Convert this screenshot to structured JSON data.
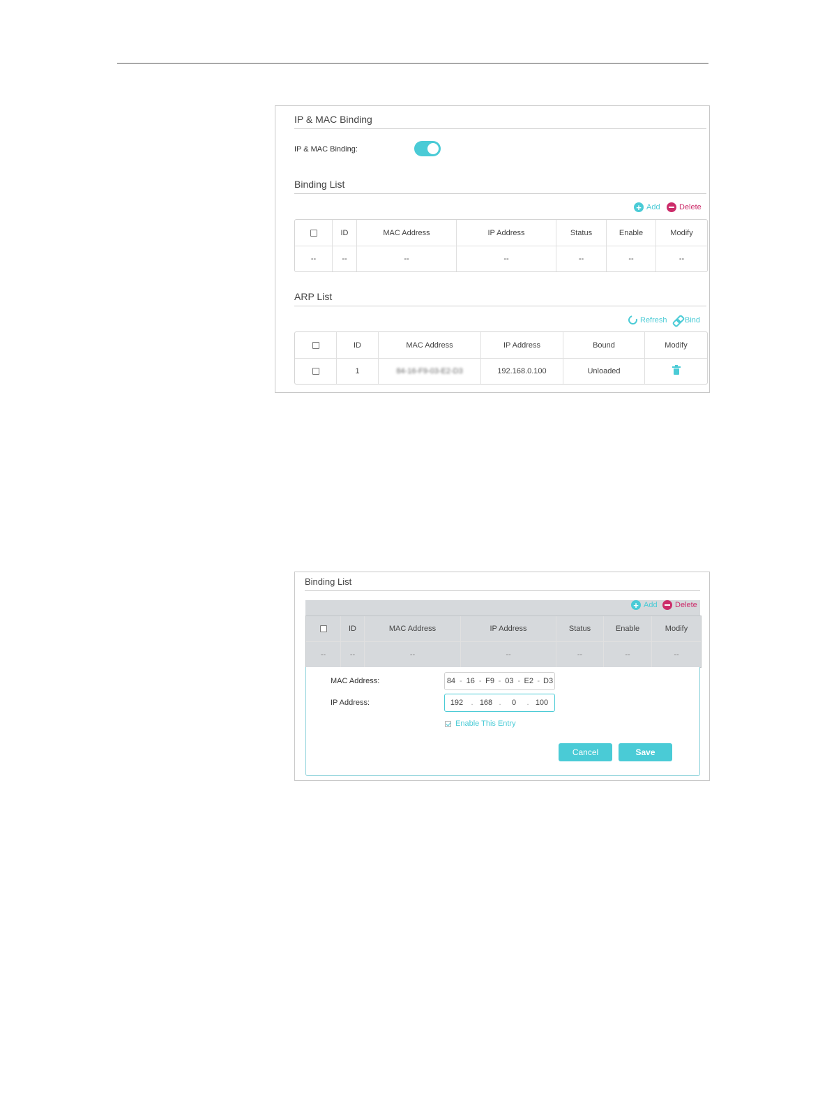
{
  "panel1": {
    "title": "IP & MAC Binding",
    "toggle_label": "IP & MAC Binding:",
    "toggle_on": true,
    "binding_list": {
      "title": "Binding List",
      "add_label": "Add",
      "delete_label": "Delete",
      "columns": [
        "ID",
        "MAC Address",
        "IP Address",
        "Status",
        "Enable",
        "Modify"
      ],
      "empty_row": [
        "--",
        "--",
        "--",
        "--",
        "--",
        "--",
        "--"
      ]
    },
    "arp_list": {
      "title": "ARP List",
      "refresh_label": "Refresh",
      "bind_label": "Bind",
      "columns": [
        "ID",
        "MAC Address",
        "IP Address",
        "Bound",
        "Modify"
      ],
      "rows": [
        {
          "id": "1",
          "mac": "84-16-F9-03-E2-D3",
          "ip": "192.168.0.100",
          "bound": "Unloaded"
        }
      ]
    }
  },
  "panel2": {
    "title": "Binding List",
    "add_label": "Add",
    "delete_label": "Delete",
    "columns": [
      "ID",
      "MAC Address",
      "IP Address",
      "Status",
      "Enable",
      "Modify"
    ],
    "empty_row": [
      "--",
      "--",
      "--",
      "--",
      "--",
      "--",
      "--"
    ],
    "form": {
      "mac_label": "MAC Address:",
      "mac_segments": [
        "84",
        "16",
        "F9",
        "03",
        "E2",
        "D3"
      ],
      "mac_sep": "-",
      "ip_label": "IP Address:",
      "ip_segments": [
        "192",
        "168",
        "0",
        "100"
      ],
      "ip_sep": ".",
      "enable_label": "Enable This Entry",
      "enable_checked": true,
      "cancel_label": "Cancel",
      "save_label": "Save"
    }
  },
  "colors": {
    "accent": "#4acbd6",
    "delete": "#cc2c6a",
    "gray_overlay": "#d6d9dc"
  }
}
